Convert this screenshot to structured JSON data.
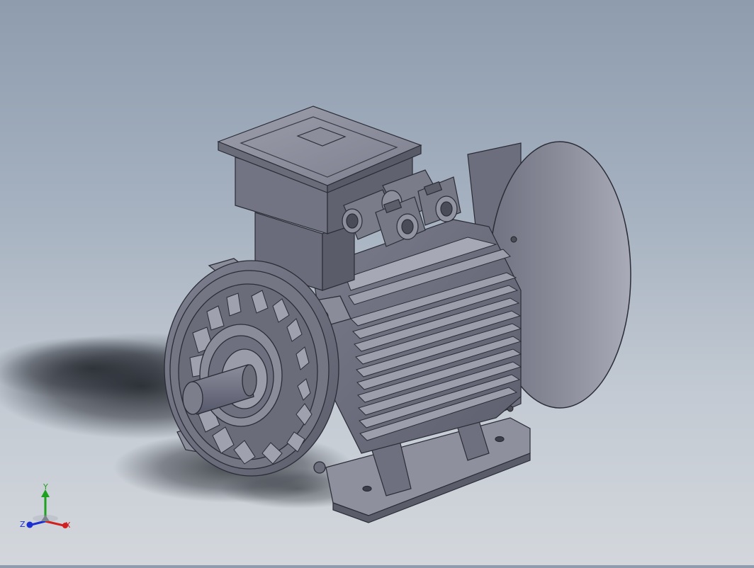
{
  "viewport": {
    "model": "electric-motor",
    "background_top": "#8e9cae",
    "background_bottom": "#d3d7dc"
  },
  "triad": {
    "x_label": "X",
    "y_label": "Y",
    "z_label": "Z",
    "x_color": "#d02020",
    "y_color": "#20a020",
    "z_color": "#1c2fd0"
  }
}
